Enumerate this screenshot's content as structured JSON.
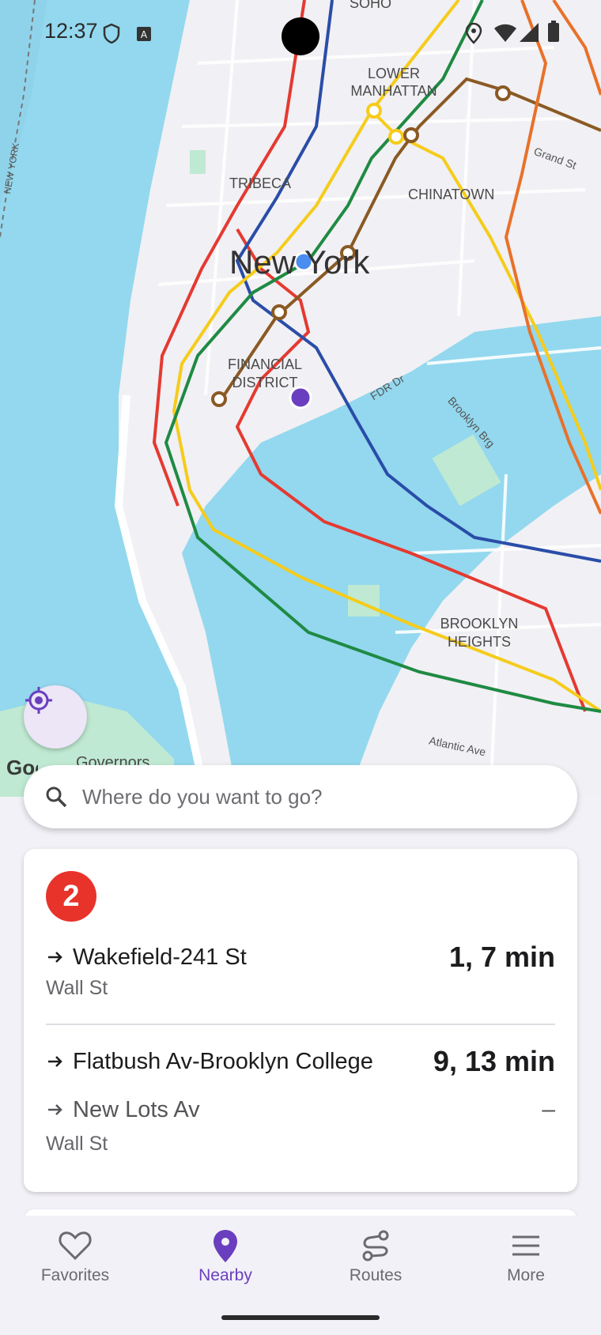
{
  "status_bar": {
    "time": "12:37"
  },
  "map": {
    "city_label": "New York",
    "neighborhoods": [
      "SOHO",
      "LOWER MANHATTAN",
      "TRIBECA",
      "CHINATOWN",
      "FINANCIAL DISTRICT",
      "BROOKLYN HEIGHTS"
    ],
    "streets": [
      "Grand St",
      "FDR Dr",
      "Brooklyn Brg",
      "Atlantic Ave",
      "NEW YORK"
    ],
    "attribution": "Google",
    "partial_label": "Governors"
  },
  "search": {
    "placeholder": "Where do you want to go?"
  },
  "card": {
    "route": "2",
    "route_color": "#e8332b",
    "departures": [
      {
        "destination": "Wakefield-241 St",
        "eta": "1, 7 min"
      },
      {
        "destination": "Flatbush Av-Brooklyn College",
        "eta": "9, 13 min"
      },
      {
        "destination": "New Lots Av",
        "eta": "–"
      }
    ],
    "stop_1": "Wall St",
    "stop_2": "Wall St"
  },
  "nav": {
    "items": [
      {
        "label": "Favorites",
        "icon": "heart-icon"
      },
      {
        "label": "Nearby",
        "icon": "location-pin-icon"
      },
      {
        "label": "Routes",
        "icon": "routes-icon"
      },
      {
        "label": "More",
        "icon": "menu-icon"
      }
    ],
    "active": "Nearby",
    "accent_color": "#6a3fbf"
  }
}
